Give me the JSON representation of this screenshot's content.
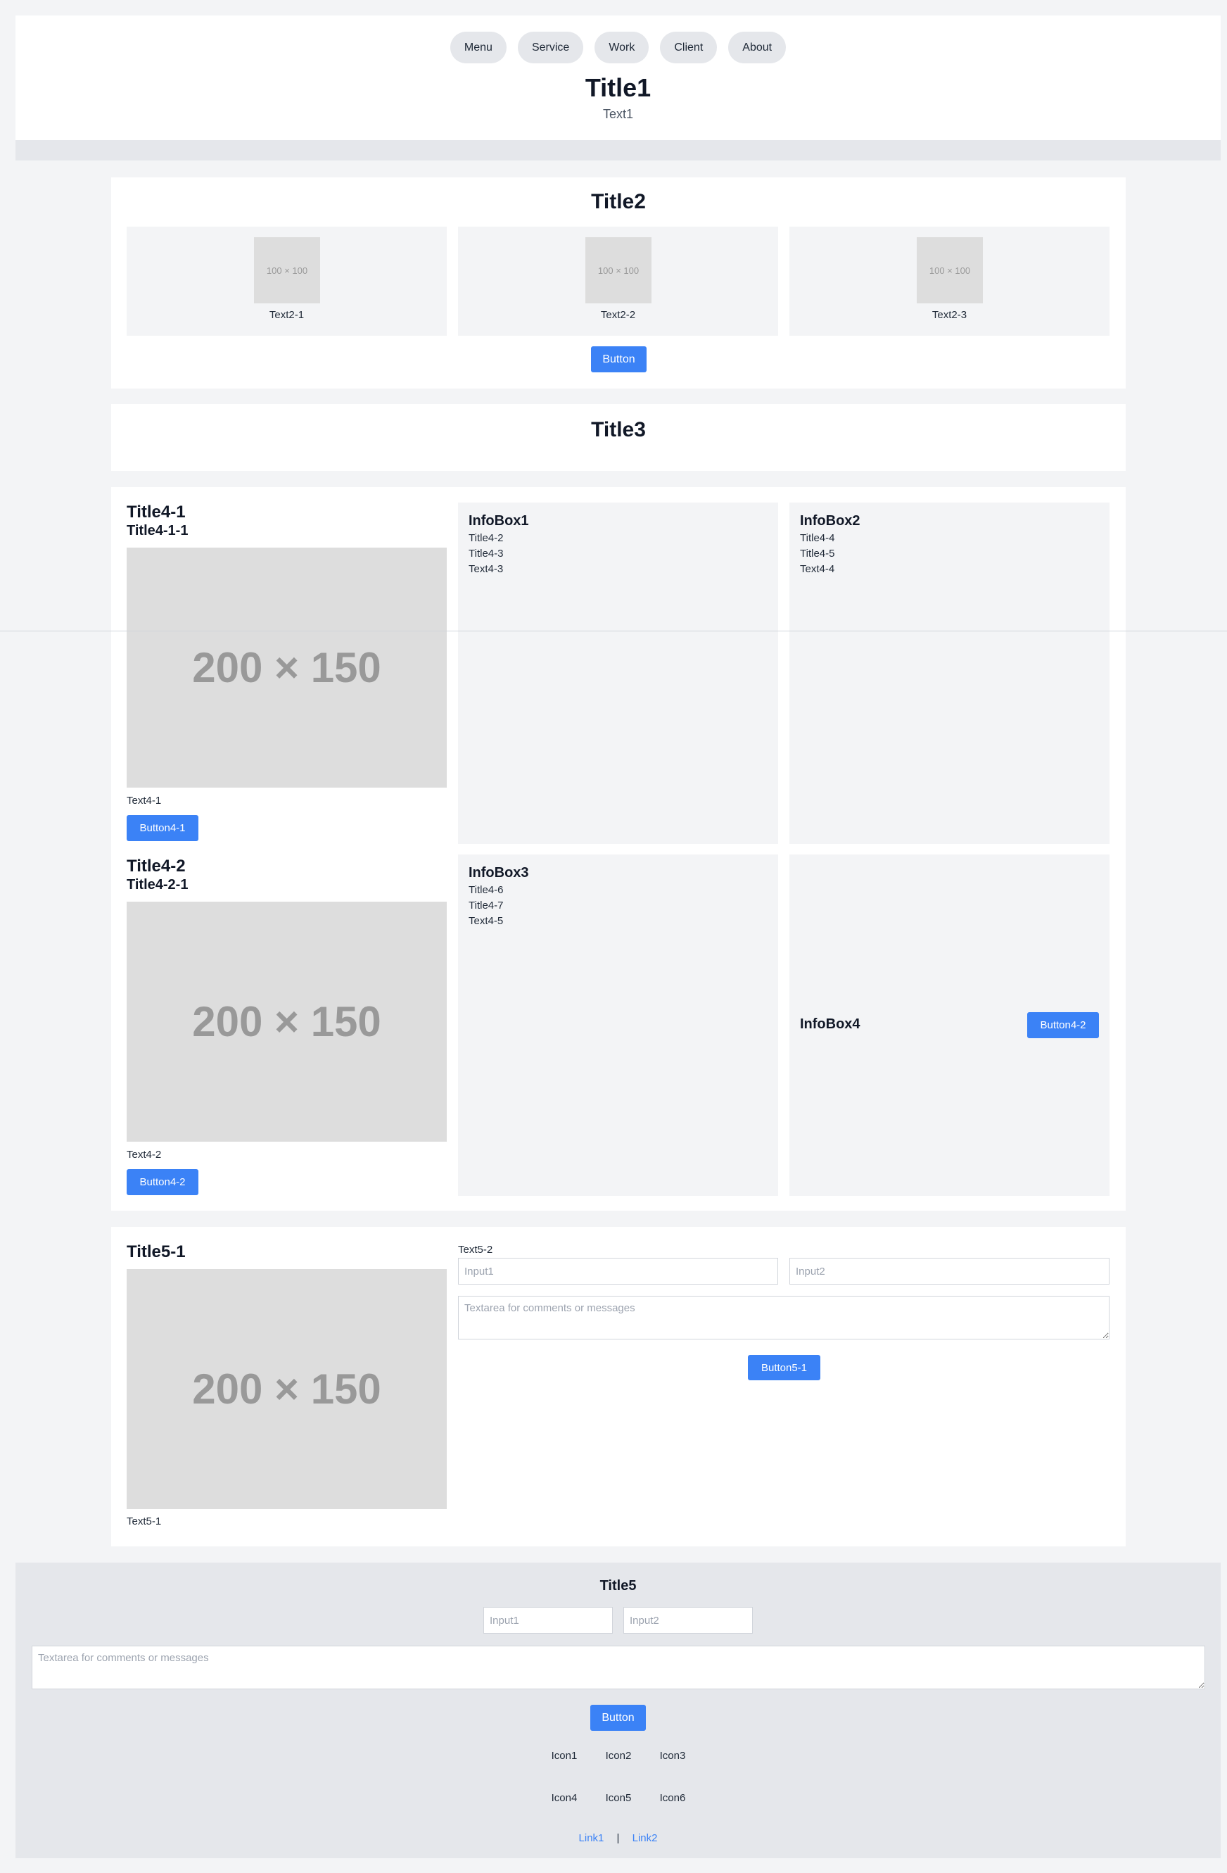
{
  "header": {
    "nav": [
      "Menu",
      "Service",
      "Work",
      "Client",
      "About"
    ],
    "title": "Title1",
    "subtitle": "Text1"
  },
  "section2": {
    "title": "Title2",
    "cards": [
      {
        "placeholder": "100 × 100",
        "text": "Text2-1"
      },
      {
        "placeholder": "100 × 100",
        "text": "Text2-2"
      },
      {
        "placeholder": "100 × 100",
        "text": "Text2-3"
      }
    ],
    "button": "Button"
  },
  "section3": {
    "title": "Title3"
  },
  "section4": {
    "col1a": {
      "title": "Title4-1",
      "subtitle": "Title4-1-1",
      "placeholder": "200 × 150",
      "text": "Text4-1",
      "button": "Button4-1"
    },
    "col1b": {
      "title": "Title4-2",
      "subtitle": "Title4-2-1",
      "placeholder": "200 × 150",
      "text": "Text4-2",
      "button": "Button4-2"
    },
    "infobox1": {
      "title": "InfoBox1",
      "lines": [
        "Title4-2",
        "Title4-3",
        "Text4-3"
      ]
    },
    "infobox2": {
      "title": "InfoBox2",
      "lines": [
        "Title4-4",
        "Title4-5",
        "Text4-4"
      ]
    },
    "infobox3": {
      "title": "InfoBox3",
      "lines": [
        "Title4-6",
        "Title4-7",
        "Text4-5"
      ]
    },
    "infobox4": {
      "title": "InfoBox4",
      "button": "Button4-2"
    }
  },
  "section5": {
    "title": "Title5-1",
    "placeholder": "200 × 150",
    "text1": "Text5-1",
    "text2": "Text5-2",
    "input1_placeholder": "Input1",
    "input2_placeholder": "Input2",
    "textarea_placeholder": "Textarea for comments or messages",
    "button": "Button5-1"
  },
  "footer": {
    "title": "Title5",
    "input1_placeholder": "Input1",
    "input2_placeholder": "Input2",
    "textarea_placeholder": "Textarea for comments or messages",
    "button": "Button",
    "icons": [
      "Icon1",
      "Icon2",
      "Icon3",
      "Icon4",
      "Icon5",
      "Icon6"
    ],
    "links": [
      "Link1",
      "Link2"
    ],
    "link_separator": "|"
  }
}
